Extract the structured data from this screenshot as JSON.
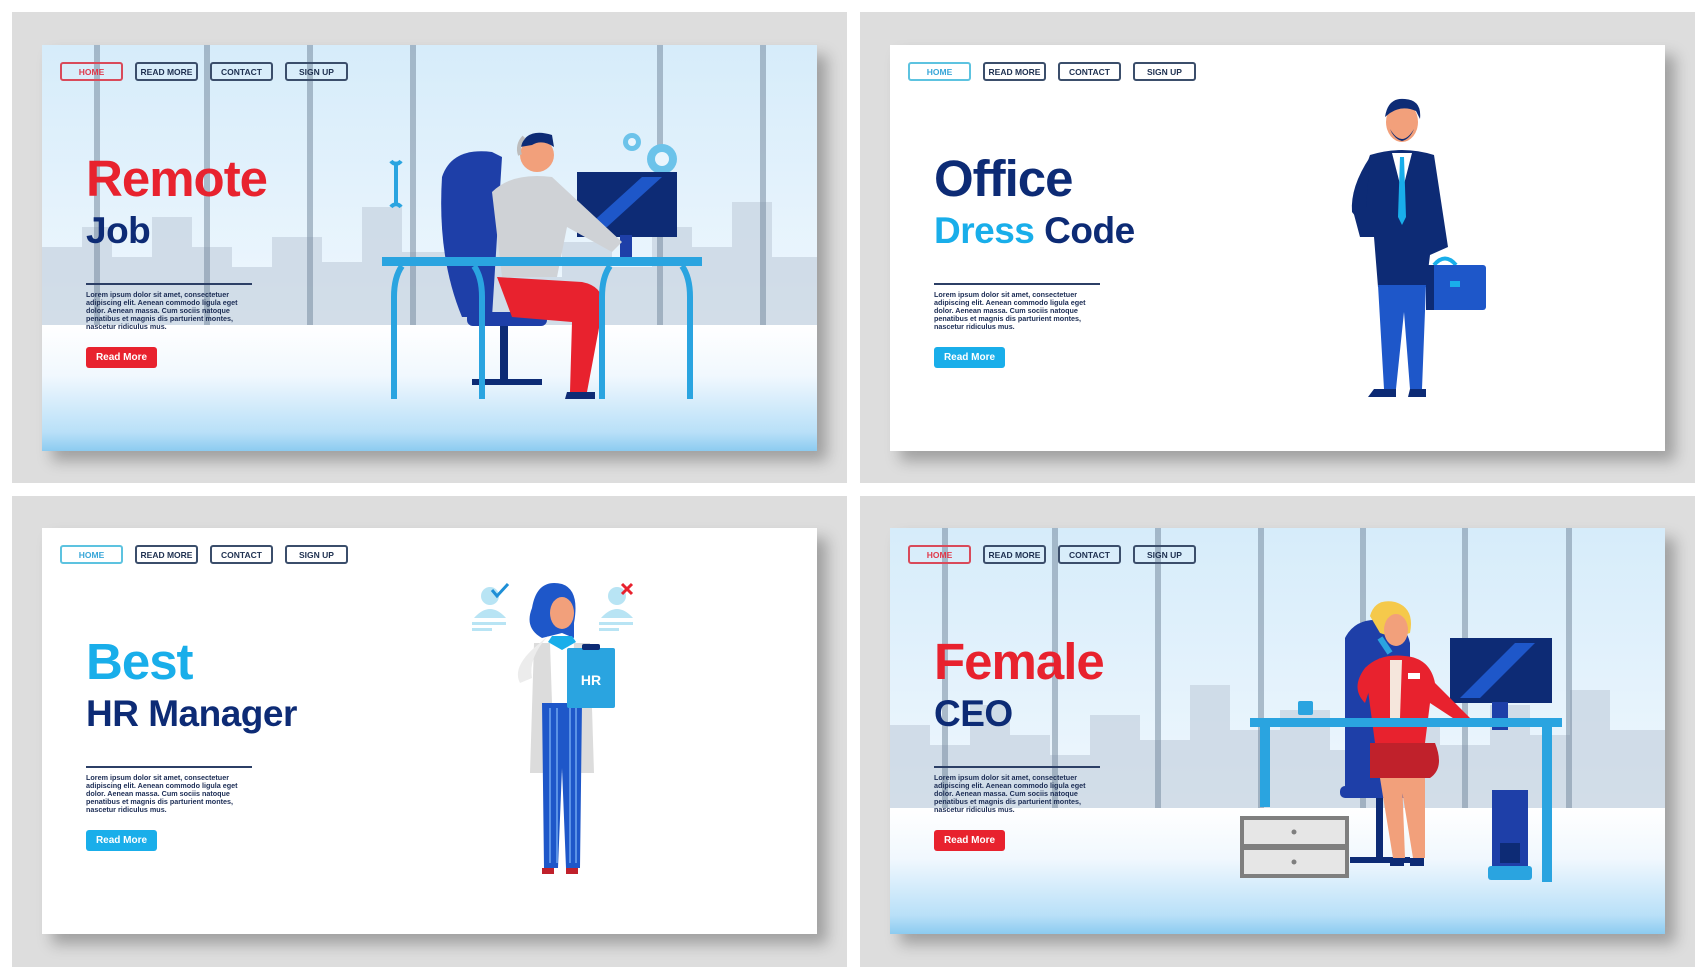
{
  "nav": {
    "home": "HOME",
    "read_more": "READ MORE",
    "contact": "CONTACT",
    "sign_up": "SIGN UP"
  },
  "lorem": "Lorem ipsum dolor sit amet, consectetuer adipiscing elit. Aenean commodo ligula eget dolor. Aenean massa. Cum sociis natoque penatibus et magnis dis parturient montes, nascetur ridiculus mus.",
  "read_more_label": "Read More",
  "colors": {
    "red": "#e8222e",
    "navy": "#0d2b75",
    "sky": "#19aeea",
    "panel_gray": "#dddddd"
  },
  "cards": [
    {
      "id": "remote-job",
      "title_line1": "Remote",
      "title_line2": "Job",
      "accent": "red",
      "illustration": "man-with-headset-at-computer-desk"
    },
    {
      "id": "office-dress-code",
      "title_line1": "Office",
      "title_line2a": "Dress",
      "title_line2b": "Code",
      "accent": "sky",
      "illustration": "businessman-with-briefcase"
    },
    {
      "id": "best-hr-manager",
      "title_line1": "Best",
      "title_line2": "HR Manager",
      "accent": "sky",
      "illustration": "hr-woman-with-clipboard",
      "clipboard_text": "HR"
    },
    {
      "id": "female-ceo",
      "title_line1": "Female",
      "title_line2": "CEO",
      "accent": "red",
      "illustration": "female-ceo-at-desk-on-phone"
    }
  ]
}
